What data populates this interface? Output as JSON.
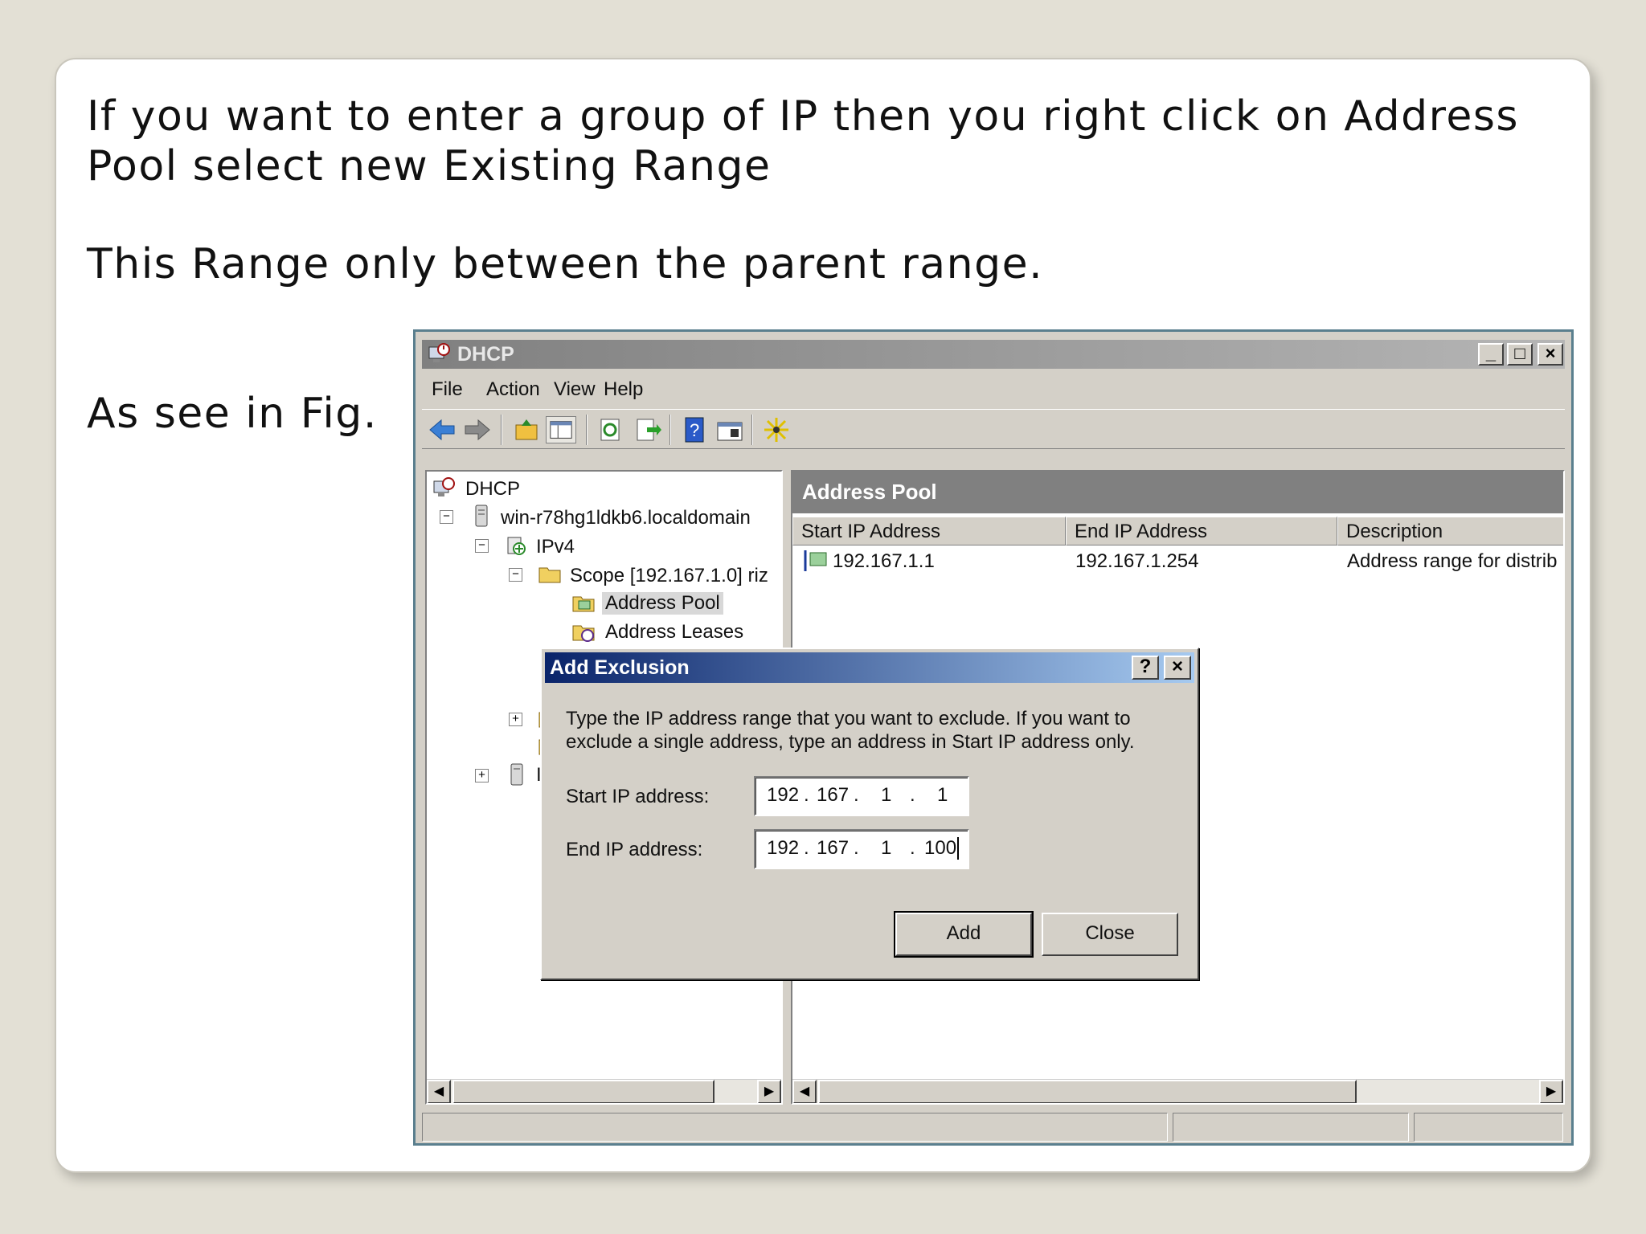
{
  "slide": {
    "line1": "If you want to enter a group of IP then you right click on Address Pool select new Existing Range",
    "line2": "This Range only between the parent range.",
    "line3": "As see in Fig."
  },
  "window": {
    "title": "DHCP",
    "menu": [
      "File",
      "Action",
      "View",
      "Help"
    ],
    "controls": {
      "minimize": "_",
      "maximize": "□",
      "close": "×"
    }
  },
  "tree": {
    "root": "DHCP",
    "server": "win-r78hg1ldkb6.localdomain",
    "ipv4": "IPv4",
    "scope": "Scope [192.167.1.0] riz",
    "address_pool": "Address Pool",
    "address_leases": "Address Leases",
    "partial_node": "I",
    "expand_plus": "+",
    "collapse_minus": "−"
  },
  "pane": {
    "title": "Address Pool",
    "columns": [
      "Start IP Address",
      "End IP Address",
      "Description"
    ],
    "rows": [
      {
        "start": "192.167.1.1",
        "end": "192.167.1.254",
        "description": "Address range for distrib"
      }
    ]
  },
  "dialog": {
    "title": "Add Exclusion",
    "help_btn": "?",
    "close_btn": "×",
    "description": "Type the IP address range that you want to exclude. If you want to exclude a single address, type an address in Start IP address only.",
    "start_label": "Start IP address:",
    "end_label": "End IP address:",
    "start_ip": [
      "192",
      "167",
      "1",
      "1"
    ],
    "end_ip": [
      "192",
      "167",
      "1",
      "100"
    ],
    "add_label": "Add",
    "close_label": "Close"
  },
  "scroll": {
    "left": "◀",
    "right": "▶"
  }
}
